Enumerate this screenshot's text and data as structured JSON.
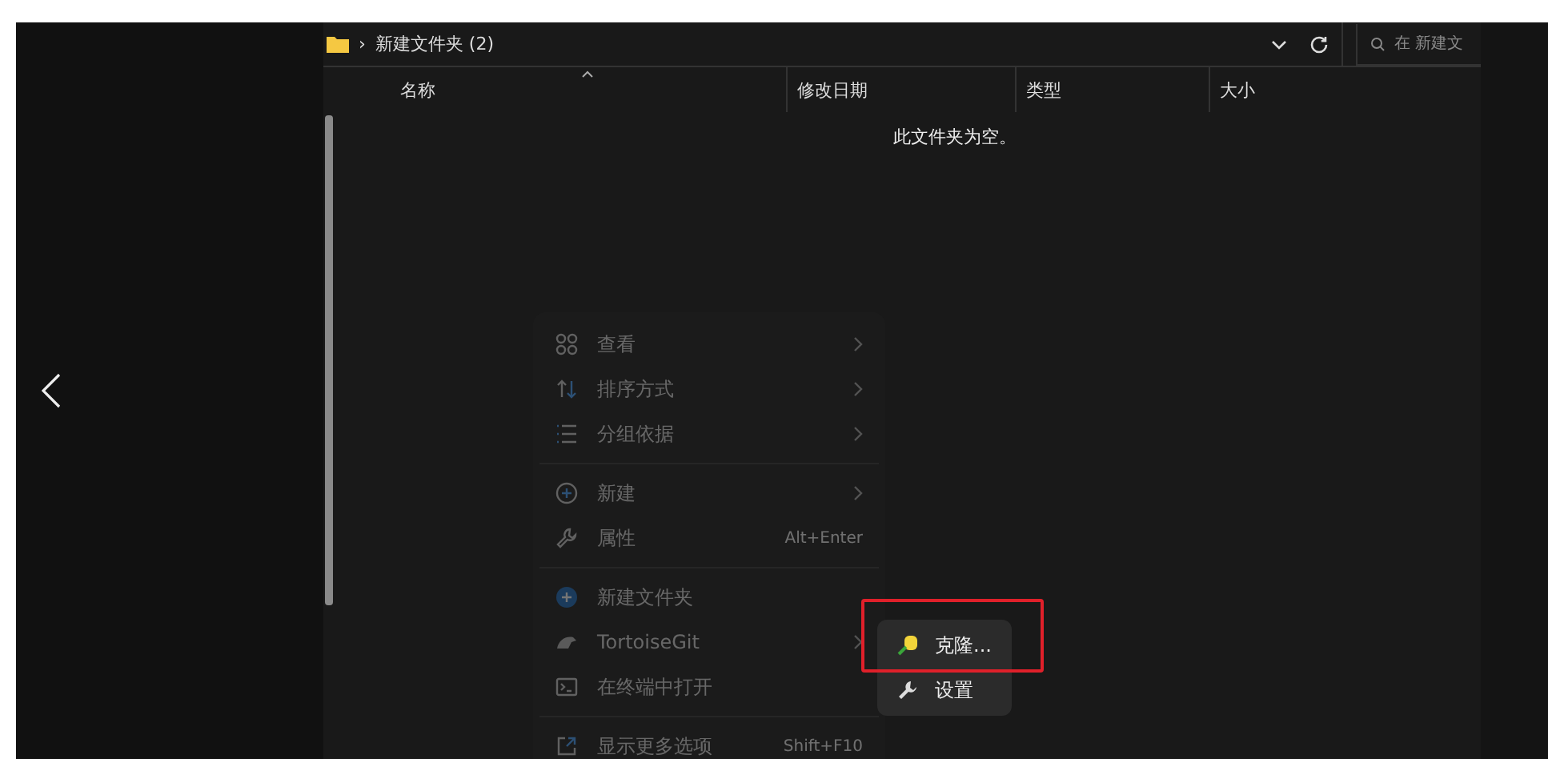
{
  "address_bar": {
    "separator": "›",
    "folder_name": "新建文件夹 (2)",
    "search": {
      "placeholder": "在 新建文"
    }
  },
  "columns": [
    {
      "label": "名称",
      "sorted": true
    },
    {
      "label": "修改日期",
      "sorted": false
    },
    {
      "label": "类型",
      "sorted": false
    },
    {
      "label": "大小",
      "sorted": false
    }
  ],
  "empty_message": "此文件夹为空。",
  "context_menu": {
    "faded": true,
    "items": [
      {
        "kind": "item",
        "label": "查看",
        "submenu": true
      },
      {
        "kind": "item",
        "label": "排序方式",
        "submenu": true
      },
      {
        "kind": "item",
        "label": "分组依据",
        "submenu": true
      },
      {
        "kind": "separator"
      },
      {
        "kind": "item",
        "label": "新建",
        "submenu": true
      },
      {
        "kind": "item",
        "label": "属性",
        "submenu": false,
        "shortcut": "Alt+Enter"
      },
      {
        "kind": "separator"
      },
      {
        "kind": "item",
        "label": "新建文件夹",
        "submenu": false
      },
      {
        "kind": "item",
        "label": "TortoiseGit",
        "submenu": true
      },
      {
        "kind": "item",
        "label": "在终端中打开",
        "submenu": false
      },
      {
        "kind": "separator"
      },
      {
        "kind": "item",
        "label": "显示更多选项",
        "submenu": false,
        "shortcut": "Shift+F10"
      }
    ]
  },
  "submenu": {
    "items": [
      {
        "label": "克隆...",
        "highlighted": true
      },
      {
        "label": "设置",
        "highlighted": false
      }
    ]
  }
}
